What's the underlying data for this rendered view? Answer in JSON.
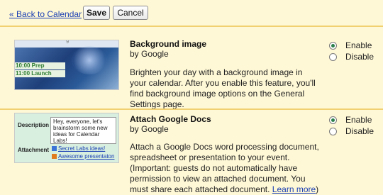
{
  "toolbar": {
    "back_label": "« Back to Calendar",
    "save_label": "Save",
    "cancel_label": "Cancel"
  },
  "labs": [
    {
      "title": "Background image",
      "byline": "by Google",
      "description": "Brighten your day with a background image in your calendar. After you enable this feature, you'll find background image options on the General Settings page.",
      "options": [
        "Enable",
        "Disable"
      ],
      "selected": "Enable",
      "thumb": {
        "top_label": "9",
        "events": [
          "10:00 Prep",
          "11:00 Launch"
        ]
      }
    },
    {
      "title": "Attach Google Docs",
      "byline": "by Google",
      "description": "Attach a Google Docs word processing document, spreadsheet or presentation to your event. (Important: guests do not automatically have permission to view an attached document. You must share each attached document. ",
      "link_text": "Learn more",
      "after_link": ")",
      "options": [
        "Enable",
        "Disable"
      ],
      "selected": "Enable",
      "thumb": {
        "description_label": "Description",
        "description_text": "Hey, everyone, let's brainstorm some new ideas for Calendar Labs!",
        "attachment_label": "Attachment",
        "attachments": [
          "Secret Labs ideas!",
          "Awesome presentaton"
        ]
      }
    }
  ],
  "colors": {
    "background": "#fff8d6",
    "divider": "#f0d070",
    "link": "#1a3fb4"
  }
}
